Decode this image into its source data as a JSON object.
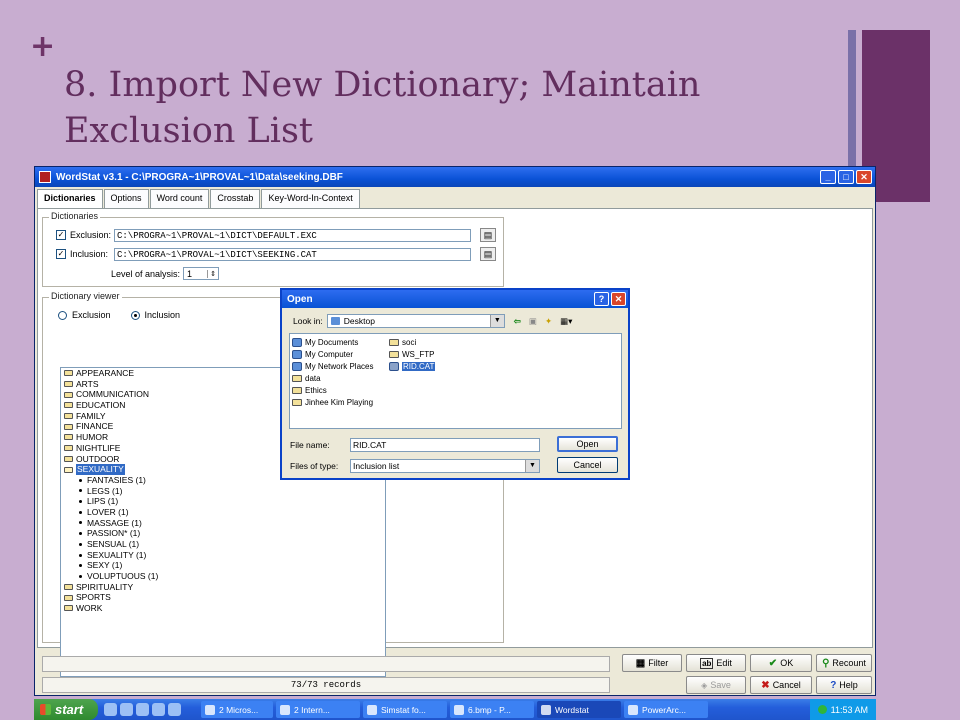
{
  "slide": {
    "plus": "+",
    "title_line1": "8. Import New Dictionary; Maintain",
    "title_line2": "Exclusion List",
    "colors": {
      "background": "#c8add0",
      "title": "#622e5e",
      "accent_bar": "#6b3168"
    }
  },
  "window": {
    "title": "WordStat v3.1 - C:\\PROGRA~1\\PROVAL~1\\Data\\seeking.DBF",
    "controls": {
      "minimize": "_",
      "maximize": "□",
      "close": "✕"
    },
    "tabs": [
      "Dictionaries",
      "Options",
      "Word count",
      "Crosstab",
      "Key-Word-In-Context"
    ],
    "active_tab": "Dictionaries"
  },
  "dictionaries": {
    "group_label": "Dictionaries",
    "exclusion": {
      "label": "Exclusion:",
      "checked": true,
      "path": "C:\\PROGRA~1\\PROVAL~1\\DICT\\DEFAULT.EXC"
    },
    "inclusion": {
      "label": "Inclusion:",
      "checked": true,
      "path": "C:\\PROGRA~1\\PROVAL~1\\DICT\\SEEKING.CAT"
    },
    "level_label": "Level of analysis:",
    "level_value": "1"
  },
  "viewer": {
    "group_label": "Dictionary viewer",
    "radio_exclusion": "Exclusion",
    "radio_inclusion": "Inclusion",
    "selected_radio": "Inclusion",
    "items": [
      {
        "type": "folder",
        "label": "APPEARANCE"
      },
      {
        "type": "folder",
        "label": "ARTS"
      },
      {
        "type": "folder",
        "label": "COMMUNICATION"
      },
      {
        "type": "folder",
        "label": "EDUCATION"
      },
      {
        "type": "folder",
        "label": "FAMILY"
      },
      {
        "type": "folder",
        "label": "FINANCE"
      },
      {
        "type": "folder",
        "label": "HUMOR"
      },
      {
        "type": "folder",
        "label": "NIGHTLIFE"
      },
      {
        "type": "folder",
        "label": "OUTDOOR"
      },
      {
        "type": "folder-open",
        "label": "SEXUALITY",
        "selected": true
      },
      {
        "type": "word",
        "label": "FANTASIES (1)"
      },
      {
        "type": "word",
        "label": "LEGS (1)"
      },
      {
        "type": "word",
        "label": "LIPS (1)"
      },
      {
        "type": "word",
        "label": "LOVER (1)"
      },
      {
        "type": "word",
        "label": "MASSAGE (1)"
      },
      {
        "type": "word",
        "label": "PASSION* (1)"
      },
      {
        "type": "word",
        "label": "SENSUAL (1)"
      },
      {
        "type": "word",
        "label": "SEXUALITY (1)"
      },
      {
        "type": "word",
        "label": "SEXY (1)"
      },
      {
        "type": "word",
        "label": "VOLUPTUOUS (1)"
      },
      {
        "type": "folder",
        "label": "SPIRITUALITY"
      },
      {
        "type": "folder",
        "label": "SPORTS"
      },
      {
        "type": "folder",
        "label": "WORK"
      }
    ]
  },
  "open_dialog": {
    "title": "Open",
    "help_btn": "?",
    "close_btn": "✕",
    "look_in_label": "Look in:",
    "look_in_value": "Desktop",
    "files": [
      {
        "label": "My Documents",
        "icon": "my-documents-icon"
      },
      {
        "label": "My Computer",
        "icon": "my-computer-icon"
      },
      {
        "label": "My Network Places",
        "icon": "network-places-icon"
      },
      {
        "label": "data",
        "icon": "folder-icon"
      },
      {
        "label": "Ethics",
        "icon": "folder-icon"
      },
      {
        "label": "Jinhee Kim Playing",
        "icon": "folder-icon"
      },
      {
        "label": "soci",
        "icon": "folder-icon"
      },
      {
        "label": "WS_FTP",
        "icon": "folder-icon"
      },
      {
        "label": "RID.CAT",
        "icon": "cat-file-icon",
        "selected": true
      }
    ],
    "file_name_label": "File name:",
    "file_name_value": "RID.CAT",
    "file_type_label": "Files of type:",
    "file_type_value": "Inclusion list",
    "open_btn": "Open",
    "cancel_btn": "Cancel"
  },
  "bottom": {
    "records": "73/73 records",
    "filter": "Filter",
    "edit": "Edit",
    "ok": "OK",
    "recount": "Recount",
    "save": "Save",
    "cancel": "Cancel",
    "help": "Help"
  },
  "taskbar": {
    "start": "start",
    "tasks": [
      "2 Micros...",
      "2 Intern...",
      "Simstat fo...",
      "6.bmp - P...",
      "Wordstat",
      "PowerArc..."
    ],
    "active_task": "Wordstat",
    "clock": "11:53 AM"
  }
}
